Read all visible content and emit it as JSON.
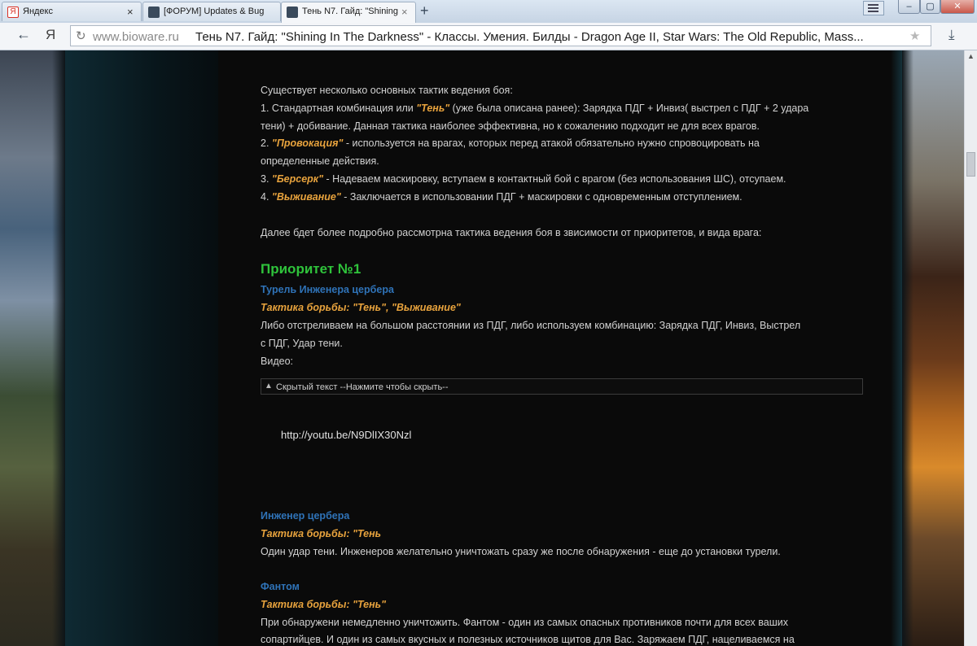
{
  "tabs": [
    {
      "title": "Яндекс",
      "close": "×",
      "favicon_color": "#d93025"
    },
    {
      "title": "[ФОРУМ] Updates & Bug",
      "close": "×",
      "favicon_color": "#3a4a5c"
    },
    {
      "title": "Тень N7. Гайд: \"Shining",
      "close": "×",
      "favicon_color": "#3a4a5c"
    }
  ],
  "new_tab": "+",
  "window_buttons": {
    "minimize": "–",
    "maximize": "▢",
    "close": "✕"
  },
  "nav": {
    "back": "←",
    "yandex_logo": "Я",
    "reload": "↻",
    "star": "★",
    "download": "⤓"
  },
  "address": {
    "domain": "www.bioware.ru",
    "title": "Тень N7. Гайд: \"Shining In The Darkness\" - Классы. Умения. Билды - Dragon Age II, Star Wars: The Old Republic, Mass..."
  },
  "article": {
    "intro": "Существует несколько основных тактик ведения боя:",
    "l1a": "1. Стандартная комбинация или ",
    "l1b": "\"Тень\"",
    "l1c": " (уже была описана ранее): Зарядка ПДГ + Инвиз( выстрел с ПДГ + 2 удара",
    "l1d": "тени) + добивание. Данная тактика наиболее эффективна, но к сожалению подходит не для всех врагов.",
    "l2a": "2. ",
    "l2b": "\"Провокация\"",
    "l2c": " - используется на врагах, которых перед атакой обязательно нужно спровоцировать на",
    "l2d": "определенные действия.",
    "l3a": "3. ",
    "l3b": "\"Берсерк\"",
    "l3c": " - Надеваем маскировку, вступаем в контактный бой с врагом (без использования ШС), отсупаем.",
    "l4a": "4. ",
    "l4b": "\"Выживание\"",
    "l4c": " - Заключается в использовании ПДГ + маскировки с одновременным отступлением.",
    "further": "Далее бдет более подробно рассмотрна тактика ведения боя в звисимости от приоритетов, и вида врага:",
    "priority": "Приоритет №1",
    "enemy1": "Турель Инженера цербера",
    "tactic1": "Тактика борьбы: \"Тень\", \"Выживание\"",
    "desc1a": "Либо отстреливаем на большом расстоянии из ПДГ, либо используем комбинацию: Зарядка ПДГ, Инвиз, Выстрел",
    "desc1b": "с ПДГ, Удар тени.",
    "video": "Видео:",
    "spoiler_label": "Скрытый текст",
    "spoiler_link": "--Нажмите чтобы скрыть--",
    "youtube": "http://youtu.be/N9DlIX30Nzl",
    "enemy2": "Инженер цербера",
    "tactic2": "Тактика борьбы: \"Тень",
    "desc2": "Один удар тени. Инженеров желательно уничтожать сразу же после обнаружения - еще до установки турели.",
    "enemy3": "Фантом",
    "tactic3": "Тактика борьбы: \"Тень\"",
    "desc3a": "При обнаружени немедленно уничтожить. Фантом - один из самых опасных противников почти для всех ваших",
    "desc3b": "сопартийцев. И один из самых вкусных и полезных источников щитов для Вас. Заряжаем ПДГ, нацеливаемся на"
  }
}
